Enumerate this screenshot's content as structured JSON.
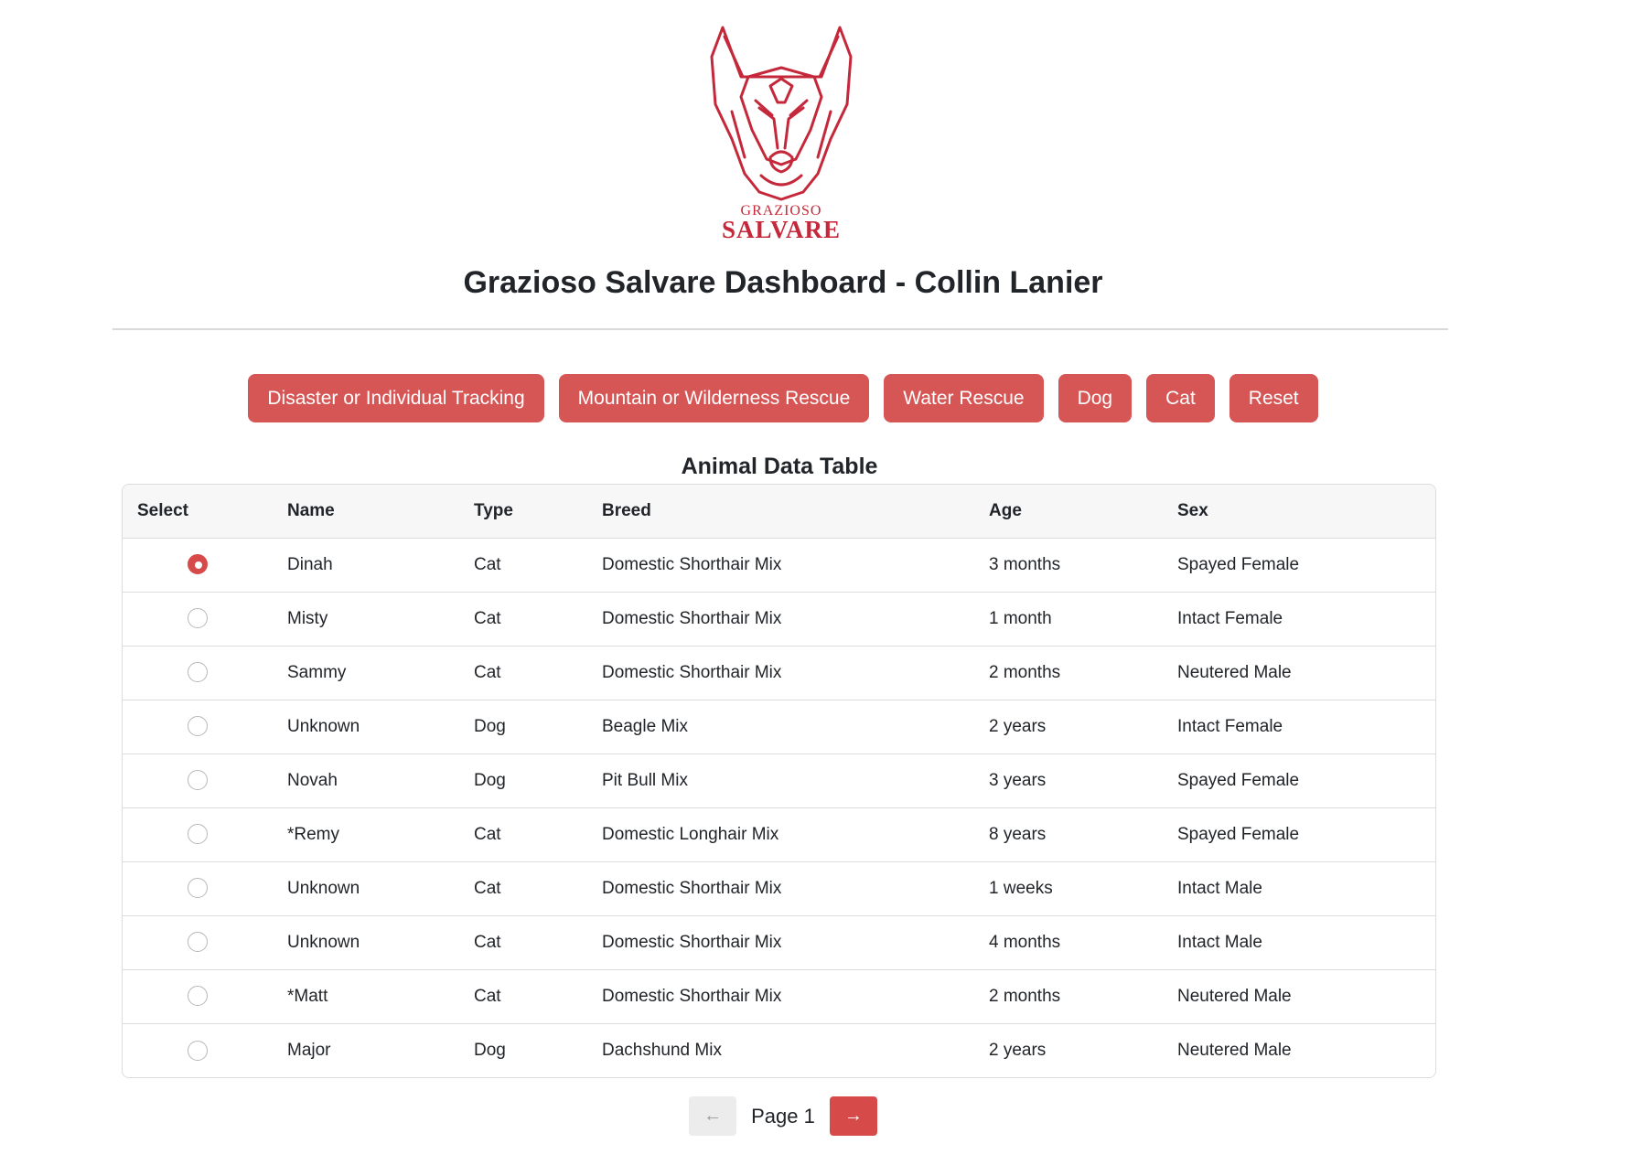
{
  "logo": {
    "icon": "german-shepherd-icon",
    "line1": "GRAZIOSO",
    "line2": "SALVARE",
    "color": "#c4283a"
  },
  "header": {
    "title": "Grazioso Salvare Dashboard - Collin Lanier"
  },
  "filters": {
    "disaster": "Disaster or Individual Tracking",
    "mountain": "Mountain or Wilderness Rescue",
    "water": "Water Rescue",
    "dog": "Dog",
    "cat": "Cat",
    "reset": "Reset",
    "color": "#d65555"
  },
  "table": {
    "title": "Animal Data Table",
    "columns": [
      "Select",
      "Name",
      "Type",
      "Breed",
      "Age",
      "Sex"
    ],
    "rows": [
      {
        "selected": true,
        "name": "Dinah",
        "type": "Cat",
        "breed": "Domestic Shorthair Mix",
        "age": "3 months",
        "sex": "Spayed Female"
      },
      {
        "selected": false,
        "name": "Misty",
        "type": "Cat",
        "breed": "Domestic Shorthair Mix",
        "age": "1 month",
        "sex": "Intact Female"
      },
      {
        "selected": false,
        "name": "Sammy",
        "type": "Cat",
        "breed": "Domestic Shorthair Mix",
        "age": "2 months",
        "sex": "Neutered Male"
      },
      {
        "selected": false,
        "name": "Unknown",
        "type": "Dog",
        "breed": "Beagle Mix",
        "age": "2 years",
        "sex": "Intact Female"
      },
      {
        "selected": false,
        "name": "Novah",
        "type": "Dog",
        "breed": "Pit Bull Mix",
        "age": "3 years",
        "sex": "Spayed Female"
      },
      {
        "selected": false,
        "name": "*Remy",
        "type": "Cat",
        "breed": "Domestic Longhair Mix",
        "age": "8 years",
        "sex": "Spayed Female"
      },
      {
        "selected": false,
        "name": "Unknown",
        "type": "Cat",
        "breed": "Domestic Shorthair Mix",
        "age": "1 weeks",
        "sex": "Intact Male"
      },
      {
        "selected": false,
        "name": "Unknown",
        "type": "Cat",
        "breed": "Domestic Shorthair Mix",
        "age": "4 months",
        "sex": "Intact Male"
      },
      {
        "selected": false,
        "name": "*Matt",
        "type": "Cat",
        "breed": "Domestic Shorthair Mix",
        "age": "2 months",
        "sex": "Neutered Male"
      },
      {
        "selected": false,
        "name": "Major",
        "type": "Dog",
        "breed": "Dachshund Mix",
        "age": "2 years",
        "sex": "Neutered Male"
      }
    ]
  },
  "pagination": {
    "page_label": "Page 1",
    "prev_icon": "arrow-left-icon",
    "next_icon": "arrow-right-icon",
    "prev_glyph": "←",
    "next_glyph": "→"
  }
}
